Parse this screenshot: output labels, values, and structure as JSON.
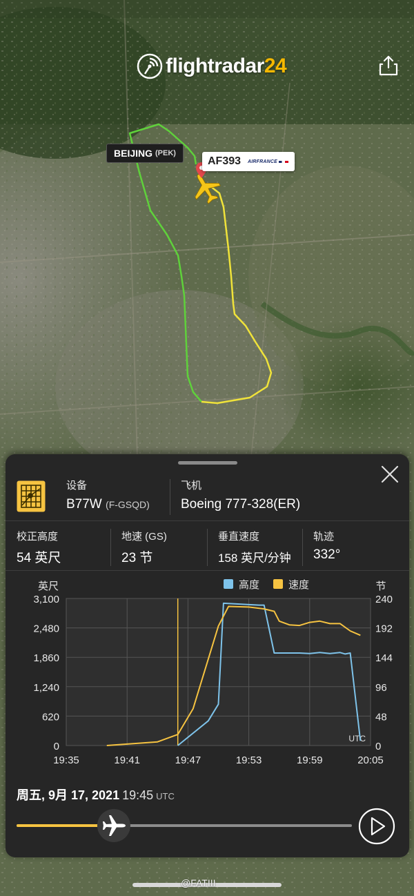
{
  "app": {
    "logo_text": "flightradar",
    "logo_number": "24"
  },
  "map": {
    "airport_label": {
      "name": "BEIJING",
      "code": "(PEK)"
    },
    "flight_label": {
      "flight": "AF393",
      "airline_logo_text": "AIRFRANCE"
    },
    "colors": {
      "track_green": "#5fd13b",
      "track_yellow": "#f0e33a",
      "aircraft": "#f5c518"
    }
  },
  "panel": {
    "aircraft": {
      "equipment_label": "设备",
      "equipment_value": "B77W",
      "registration": "(F-GSQD)",
      "aircraft_label": "飞机",
      "aircraft_value": "Boeing 777-328(ER)"
    },
    "stats": [
      {
        "label": "校正高度",
        "value": "54 英尺"
      },
      {
        "label": "地速 (GS)",
        "value": "23 节"
      },
      {
        "label": "垂直速度",
        "value": "158 英尺/分钟"
      },
      {
        "label": "轨迹",
        "value": "332°"
      }
    ],
    "datetime": {
      "date": "周五, 9月 17, 2021",
      "time": "19:45",
      "tz": "UTC"
    },
    "timeline_progress": 0.29
  },
  "chart_data": {
    "type": "line",
    "x_label_unit": "UTC",
    "x_ticks": [
      "19:35",
      "19:41",
      "19:47",
      "19:53",
      "19:59",
      "20:05"
    ],
    "x_range": [
      "19:35",
      "20:05"
    ],
    "y_left_label": "英尺",
    "y_left_ticks": [
      "3,100",
      "2,480",
      "1,860",
      "1,240",
      "620",
      "0"
    ],
    "y_left_range": [
      0,
      3100
    ],
    "y_right_label": "节",
    "y_right_ticks": [
      "240",
      "192",
      "144",
      "96",
      "48",
      "0"
    ],
    "y_right_range": [
      0,
      240
    ],
    "grid": true,
    "cursor_time": "19:46",
    "series": [
      {
        "name": "高度",
        "color": "#7ec3ea",
        "axis": "left",
        "x": [
          "19:46",
          "19:49",
          "19:50",
          "19:50.5",
          "19:54",
          "19:54.5",
          "19:55",
          "19:55.5",
          "19:56",
          "19:58",
          "19:59",
          "20:00",
          "20:01",
          "20:02",
          "20:02.5",
          "20:03",
          "20:04"
        ],
        "values": [
          0,
          520,
          870,
          3000,
          2960,
          2960,
          2460,
          1950,
          1950,
          1950,
          1940,
          1960,
          1940,
          1960,
          1930,
          1950,
          100
        ]
      },
      {
        "name": "速度",
        "color": "#f6c341",
        "axis": "right",
        "x": [
          "19:39",
          "19:44",
          "19:46",
          "19:47.5",
          "19:50",
          "19:51",
          "19:53",
          "19:54.5",
          "19:55.5",
          "19:56",
          "19:57",
          "19:58",
          "19:59",
          "20:00",
          "20:01",
          "20:02",
          "20:03",
          "20:04"
        ],
        "values": [
          0,
          6,
          18,
          60,
          195,
          227,
          226,
          223,
          219,
          203,
          197,
          196,
          201,
          203,
          199,
          199,
          187,
          180
        ]
      }
    ]
  },
  "watermark": "@FATIII"
}
